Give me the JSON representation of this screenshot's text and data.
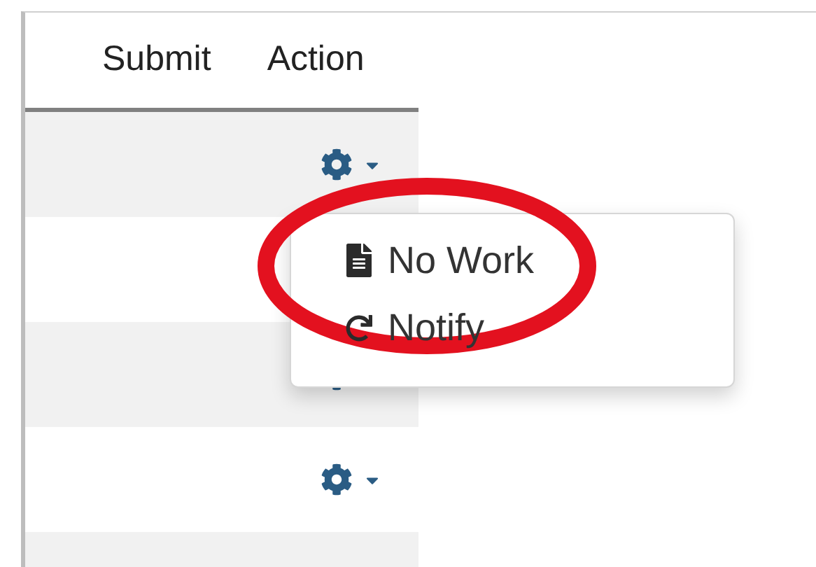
{
  "table": {
    "columns": [
      "Submit",
      "Action"
    ],
    "rows": [
      {
        "action": true
      },
      {},
      {
        "action": true
      },
      {
        "action": true
      },
      {}
    ]
  },
  "menu": {
    "items": [
      {
        "kind": "file",
        "label": "No Work"
      },
      {
        "kind": "refresh",
        "label": "Notify"
      }
    ]
  },
  "annotation": {
    "kind": "ellipse"
  }
}
